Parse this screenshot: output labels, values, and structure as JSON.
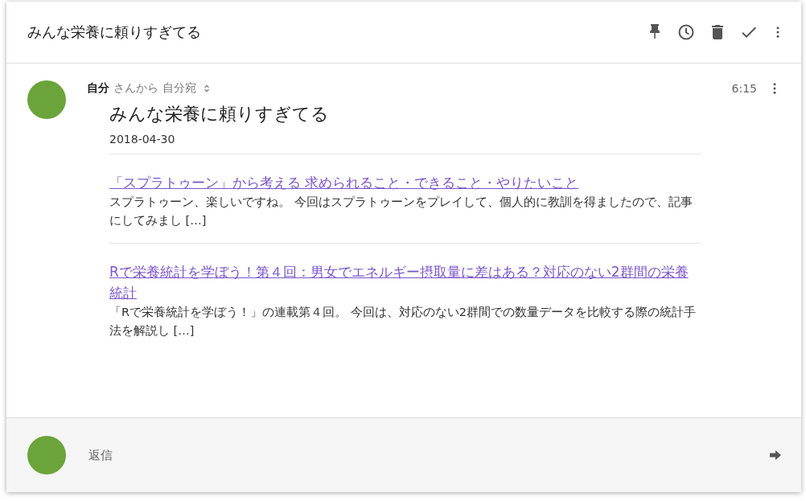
{
  "header": {
    "title": "みんな栄養に頼りすぎてる"
  },
  "message": {
    "sender": "自分",
    "from_suffix": "さんから",
    "recipient": "自分宛",
    "time": "6:15",
    "subject": "みんな栄養に頼りすぎてる",
    "date": "2018-04-30",
    "posts": [
      {
        "title": "「スプラトゥーン」から考える 求められること・できること・やりたいこと",
        "excerpt": "スプラトゥーン、楽しいですね。 今回はスプラトゥーンをプレイして、個人的に教訓を得ましたので、記事にしてみまし […]"
      },
      {
        "title": "Rで栄養統計を学ぼう！第４回：男女でエネルギー摂取量に差はある？対応のない2群間の栄養統計",
        "excerpt": "「Rで栄養統計を学ぼう！」の連載第４回。 今回は、対応のない2群間での数量データを比較する際の統計手法を解説し […]"
      }
    ]
  },
  "reply": {
    "placeholder": "返信"
  }
}
